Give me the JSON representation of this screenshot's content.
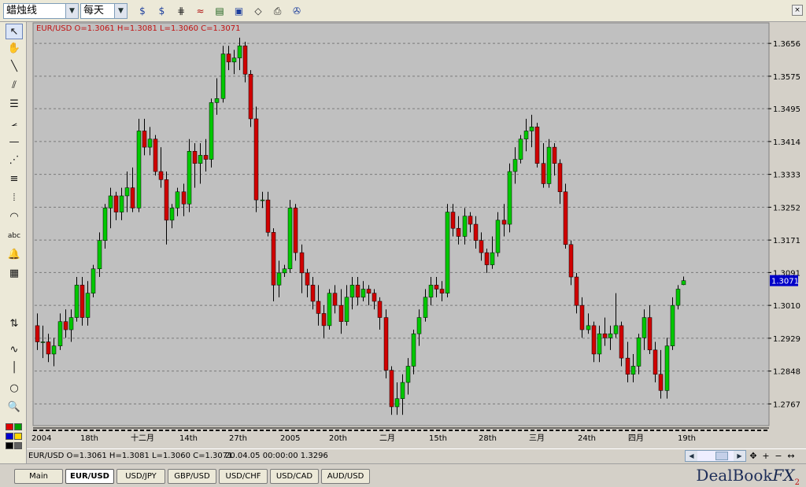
{
  "toolbar": {
    "chart_type": "蜡烛线",
    "timeframe": "每天",
    "buttons": [
      {
        "name": "indicator-dollar-icon",
        "glyph": "$"
      },
      {
        "name": "indicator-ratio-icon",
        "glyph": "$"
      },
      {
        "name": "bar-options-icon",
        "glyph": "⋕"
      },
      {
        "name": "chart-wave-icon",
        "glyph": "≈"
      },
      {
        "name": "panel-icon",
        "glyph": "▤"
      },
      {
        "name": "window-icon",
        "glyph": "▣"
      },
      {
        "name": "eraser-icon",
        "glyph": "◇"
      },
      {
        "name": "print-icon",
        "glyph": "⎙"
      },
      {
        "name": "settings-icon",
        "glyph": "✇"
      }
    ]
  },
  "tools": [
    {
      "name": "cursor-arrow-icon",
      "glyph": "↖"
    },
    {
      "name": "hand-icon",
      "glyph": "✋"
    },
    {
      "name": "trend-line-icon",
      "glyph": "╲"
    },
    {
      "name": "parallel-lines-icon",
      "glyph": "⫽"
    },
    {
      "name": "retracement-icon",
      "glyph": "☰"
    },
    {
      "name": "fan-icon",
      "glyph": "⦟"
    },
    {
      "name": "horizontal-line-icon",
      "glyph": "—"
    },
    {
      "name": "gann-fan-icon",
      "glyph": "⋰"
    },
    {
      "name": "color-lines-icon",
      "glyph": "≡"
    },
    {
      "name": "fib-time-zones-icon",
      "glyph": "⦙"
    },
    {
      "name": "arc-icon",
      "glyph": "◠"
    },
    {
      "name": "text-label-icon",
      "glyph": "abc"
    },
    {
      "name": "alert-bell-icon",
      "glyph": "🔔"
    },
    {
      "name": "calculator-icon",
      "glyph": "▦"
    },
    {
      "name": "up-down-arrow-icon",
      "glyph": "⇅"
    },
    {
      "name": "wave-icon",
      "glyph": "∿"
    },
    {
      "name": "vertical-line-icon",
      "glyph": "│"
    },
    {
      "name": "circle-icon",
      "glyph": "○"
    },
    {
      "name": "zoom-icon",
      "glyph": "🔍"
    }
  ],
  "swatches": [
    "#e00000",
    "#00a000",
    "#0000d0",
    "#ffd800",
    "#000000",
    "#606060"
  ],
  "chart": {
    "info": "EUR/USD O=1.3061 H=1.3081 L=1.3060 C=1.3071",
    "last_price": "1.3071",
    "price_labels": [
      "1.3656",
      "1.3575",
      "1.3495",
      "1.3414",
      "1.3333",
      "1.3252",
      "1.3171",
      "1.3091",
      "1.3010",
      "1.2929",
      "1.2848",
      "1.2767"
    ],
    "date_labels": [
      "2004",
      "18th",
      "十二月",
      "14th",
      "27th",
      "2005",
      "20th",
      "二月",
      "15th",
      "28th",
      "三月",
      "24th",
      "四月",
      "19th"
    ],
    "colors": {
      "up": "#00c800",
      "down": "#d00000",
      "grid": "#7a7a7a",
      "wick": "#000000"
    }
  },
  "chart_data": {
    "type": "candlestick",
    "symbol": "EUR/USD",
    "ylim": [
      1.2727,
      1.3697
    ],
    "ohlc": [
      [
        1.296,
        1.299,
        1.29,
        1.292
      ],
      [
        1.292,
        1.296,
        1.288,
        1.292
      ],
      [
        1.292,
        1.294,
        1.287,
        1.289
      ],
      [
        1.289,
        1.293,
        1.286,
        1.291
      ],
      [
        1.291,
        1.299,
        1.29,
        1.297
      ],
      [
        1.297,
        1.3,
        1.293,
        1.295
      ],
      [
        1.295,
        1.3,
        1.292,
        1.298
      ],
      [
        1.298,
        1.308,
        1.297,
        1.306
      ],
      [
        1.306,
        1.308,
        1.296,
        1.298
      ],
      [
        1.298,
        1.307,
        1.296,
        1.304
      ],
      [
        1.304,
        1.311,
        1.303,
        1.31
      ],
      [
        1.31,
        1.319,
        1.308,
        1.317
      ],
      [
        1.317,
        1.326,
        1.315,
        1.325
      ],
      [
        1.325,
        1.33,
        1.32,
        1.328
      ],
      [
        1.328,
        1.329,
        1.322,
        1.324
      ],
      [
        1.324,
        1.33,
        1.322,
        1.328
      ],
      [
        1.328,
        1.334,
        1.324,
        1.33
      ],
      [
        1.33,
        1.335,
        1.324,
        1.325
      ],
      [
        1.325,
        1.347,
        1.324,
        1.344
      ],
      [
        1.344,
        1.347,
        1.338,
        1.34
      ],
      [
        1.34,
        1.345,
        1.338,
        1.342
      ],
      [
        1.342,
        1.343,
        1.333,
        1.334
      ],
      [
        1.334,
        1.34,
        1.33,
        1.332
      ],
      [
        1.332,
        1.334,
        1.316,
        1.322
      ],
      [
        1.322,
        1.326,
        1.32,
        1.325
      ],
      [
        1.325,
        1.33,
        1.323,
        1.329
      ],
      [
        1.329,
        1.331,
        1.323,
        1.326
      ],
      [
        1.326,
        1.342,
        1.324,
        1.339
      ],
      [
        1.339,
        1.341,
        1.33,
        1.336
      ],
      [
        1.336,
        1.341,
        1.331,
        1.338
      ],
      [
        1.338,
        1.342,
        1.334,
        1.337
      ],
      [
        1.337,
        1.352,
        1.335,
        1.351
      ],
      [
        1.351,
        1.357,
        1.348,
        1.352
      ],
      [
        1.352,
        1.365,
        1.351,
        1.363
      ],
      [
        1.363,
        1.365,
        1.359,
        1.361
      ],
      [
        1.361,
        1.364,
        1.358,
        1.362
      ],
      [
        1.362,
        1.367,
        1.359,
        1.365
      ],
      [
        1.365,
        1.366,
        1.356,
        1.358
      ],
      [
        1.358,
        1.359,
        1.345,
        1.347
      ],
      [
        1.347,
        1.35,
        1.324,
        1.327
      ],
      [
        1.327,
        1.329,
        1.325,
        1.327
      ],
      [
        1.327,
        1.329,
        1.318,
        1.319
      ],
      [
        1.319,
        1.32,
        1.302,
        1.306
      ],
      [
        1.306,
        1.312,
        1.303,
        1.309
      ],
      [
        1.309,
        1.311,
        1.308,
        1.31
      ],
      [
        1.31,
        1.327,
        1.309,
        1.325
      ],
      [
        1.325,
        1.326,
        1.312,
        1.314
      ],
      [
        1.314,
        1.316,
        1.304,
        1.309
      ],
      [
        1.309,
        1.31,
        1.303,
        1.306
      ],
      [
        1.306,
        1.308,
        1.3,
        1.302
      ],
      [
        1.302,
        1.306,
        1.296,
        1.299
      ],
      [
        1.299,
        1.301,
        1.293,
        1.296
      ],
      [
        1.296,
        1.305,
        1.295,
        1.304
      ],
      [
        1.304,
        1.306,
        1.299,
        1.301
      ],
      [
        1.301,
        1.305,
        1.294,
        1.297
      ],
      [
        1.297,
        1.306,
        1.296,
        1.303
      ],
      [
        1.303,
        1.308,
        1.3,
        1.306
      ],
      [
        1.306,
        1.308,
        1.301,
        1.303
      ],
      [
        1.303,
        1.307,
        1.302,
        1.305
      ],
      [
        1.305,
        1.306,
        1.301,
        1.304
      ],
      [
        1.304,
        1.305,
        1.3,
        1.302
      ],
      [
        1.302,
        1.303,
        1.295,
        1.298
      ],
      [
        1.298,
        1.3,
        1.283,
        1.285
      ],
      [
        1.285,
        1.286,
        1.274,
        1.276
      ],
      [
        1.276,
        1.282,
        1.274,
        1.278
      ],
      [
        1.278,
        1.284,
        1.274,
        1.282
      ],
      [
        1.282,
        1.288,
        1.279,
        1.286
      ],
      [
        1.286,
        1.295,
        1.284,
        1.294
      ],
      [
        1.294,
        1.3,
        1.291,
        1.298
      ],
      [
        1.298,
        1.305,
        1.297,
        1.303
      ],
      [
        1.303,
        1.308,
        1.301,
        1.306
      ],
      [
        1.306,
        1.308,
        1.303,
        1.305
      ],
      [
        1.305,
        1.307,
        1.302,
        1.304
      ],
      [
        1.304,
        1.326,
        1.303,
        1.324
      ],
      [
        1.324,
        1.326,
        1.318,
        1.32
      ],
      [
        1.32,
        1.323,
        1.316,
        1.318
      ],
      [
        1.318,
        1.325,
        1.316,
        1.323
      ],
      [
        1.323,
        1.324,
        1.319,
        1.321
      ],
      [
        1.321,
        1.323,
        1.315,
        1.317
      ],
      [
        1.317,
        1.319,
        1.312,
        1.314
      ],
      [
        1.314,
        1.315,
        1.309,
        1.311
      ],
      [
        1.311,
        1.318,
        1.31,
        1.314
      ],
      [
        1.314,
        1.324,
        1.313,
        1.322
      ],
      [
        1.322,
        1.326,
        1.318,
        1.321
      ],
      [
        1.321,
        1.336,
        1.319,
        1.334
      ],
      [
        1.334,
        1.34,
        1.331,
        1.337
      ],
      [
        1.337,
        1.343,
        1.336,
        1.342
      ],
      [
        1.342,
        1.347,
        1.339,
        1.344
      ],
      [
        1.344,
        1.348,
        1.34,
        1.345
      ],
      [
        1.345,
        1.346,
        1.335,
        1.336
      ],
      [
        1.336,
        1.341,
        1.33,
        1.331
      ],
      [
        1.331,
        1.342,
        1.33,
        1.34
      ],
      [
        1.34,
        1.341,
        1.333,
        1.336
      ],
      [
        1.336,
        1.337,
        1.326,
        1.329
      ],
      [
        1.329,
        1.331,
        1.315,
        1.316
      ],
      [
        1.316,
        1.317,
        1.306,
        1.308
      ],
      [
        1.308,
        1.309,
        1.299,
        1.301
      ],
      [
        1.301,
        1.303,
        1.293,
        1.295
      ],
      [
        1.295,
        1.299,
        1.294,
        1.296
      ],
      [
        1.296,
        1.297,
        1.287,
        1.289
      ],
      [
        1.289,
        1.296,
        1.287,
        1.294
      ],
      [
        1.294,
        1.298,
        1.291,
        1.293
      ],
      [
        1.293,
        1.296,
        1.29,
        1.294
      ],
      [
        1.294,
        1.304,
        1.293,
        1.296
      ],
      [
        1.296,
        1.297,
        1.286,
        1.288
      ],
      [
        1.288,
        1.292,
        1.282,
        1.284
      ],
      [
        1.284,
        1.289,
        1.282,
        1.286
      ],
      [
        1.286,
        1.294,
        1.284,
        1.293
      ],
      [
        1.293,
        1.3,
        1.29,
        1.298
      ],
      [
        1.298,
        1.301,
        1.289,
        1.29
      ],
      [
        1.29,
        1.292,
        1.282,
        1.284
      ],
      [
        1.284,
        1.29,
        1.278,
        1.28
      ],
      [
        1.28,
        1.293,
        1.278,
        1.291
      ],
      [
        1.291,
        1.303,
        1.29,
        1.301
      ],
      [
        1.301,
        1.306,
        1.3,
        1.305
      ],
      [
        1.3061,
        1.3081,
        1.306,
        1.3071
      ]
    ]
  },
  "status": {
    "left": "EUR/USD O=1.3061 H=1.3081 L=1.3060 C=1.3071",
    "right": "20.04.05 00:00:00 1.3296"
  },
  "tabs": [
    "Main",
    "EUR/USD",
    "USD/JPY",
    "GBP/USD",
    "USD/CHF",
    "USD/CAD",
    "AUD/USD"
  ],
  "active_tab": "EUR/USD",
  "brand": {
    "name": "DealBook",
    "fx": "FX",
    "version": "2"
  }
}
